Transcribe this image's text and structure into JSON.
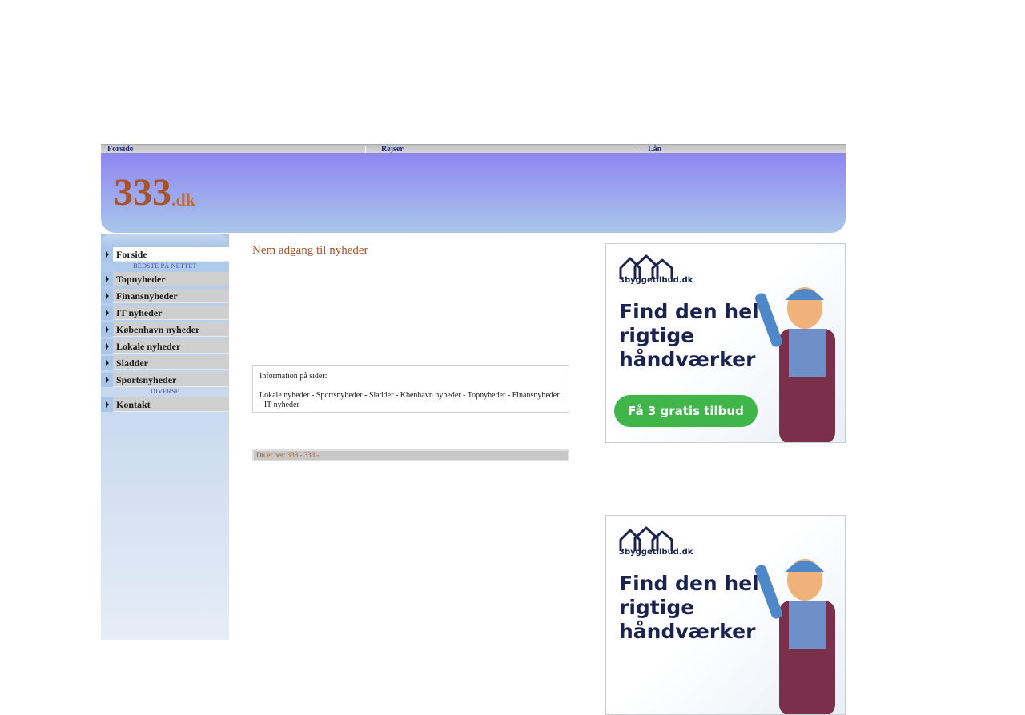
{
  "top_nav": {
    "items": [
      "Forside",
      "Rejser",
      "Lån"
    ]
  },
  "logo": {
    "main": "333",
    "suffix": ".dk"
  },
  "sidebar": {
    "groups": {
      "best": "BEDSTE PÅ NETTET",
      "misc": "DIVERSE"
    },
    "items": [
      "Forside",
      "Topnyheder",
      "Finansnyheder",
      "IT nyheder",
      "København nyheder",
      "Lokale nyheder",
      "Sladder",
      "Sportsnyheder",
      "Kontakt"
    ]
  },
  "main": {
    "heading": "Nem adgang til nyheder",
    "info_title": "Information på sider:",
    "info_links": "Lokale nyheder - Sportsnyheder - Sladder - Kbenhavn nyheder - Topnyheder - Finansnyheder - IT nyheder -",
    "breadcrumb": "Du er her: 333 - 333 -"
  },
  "ads": {
    "brand": "3byggetilbud.dk",
    "headline": "Find den helt rigtige håndværker",
    "cta": "Få 3 gratis tilbud"
  },
  "colors": {
    "accent": "#a9532a",
    "banner": "#8f86f2",
    "cta": "#3fb54a"
  }
}
